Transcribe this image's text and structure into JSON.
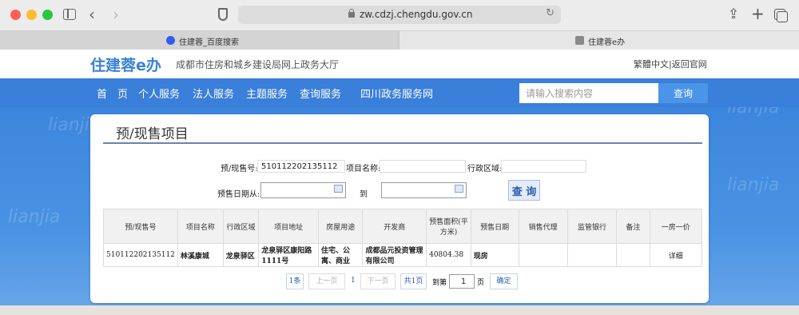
{
  "browser": {
    "url": "zw.cdzj.chengdu.gov.cn",
    "tabs": [
      {
        "label": "住建蓉_百度搜索"
      },
      {
        "label": "住建蓉e办"
      }
    ]
  },
  "site": {
    "logo": "住建蓉e办",
    "subtitle": "成都市住房和城乡建设局网上政务大厅",
    "lang_links": "繁體中文|返回官网"
  },
  "nav": {
    "items": [
      "首　页",
      "个人服务",
      "法人服务",
      "主题服务",
      "查询服务",
      "四川政务服务网"
    ],
    "search_placeholder": "请输入搜索内容",
    "search_button": "查询"
  },
  "watermark": "lianjia",
  "card": {
    "title": "预/现售项目",
    "filters": {
      "presale_no_label": "预/现售号:",
      "presale_no_value": "510112202135112",
      "project_name_label": "项目名称:",
      "district_label": "行政区域:",
      "date_from_label": "预售日期从:",
      "date_to_label": "到",
      "query_button": "查 询"
    },
    "table": {
      "headers": [
        "预/现售号",
        "项目名称",
        "行政区域",
        "项目地址",
        "房屋用途",
        "开发商",
        "预售面积(平方米)",
        "预售日期",
        "销售代理",
        "监管银行",
        "备注",
        "一房一价"
      ],
      "rows": [
        [
          "510112202135112",
          "林溪康城",
          "龙泉驿区",
          "龙泉驿区康阳路1111号",
          "住宅、公寓、商业",
          "成都品元投资管理有限公司",
          "40804.38",
          "现房",
          "",
          "",
          "",
          "详细"
        ]
      ]
    },
    "pager": {
      "count": "1条",
      "prev": "上一页",
      "current": "1",
      "next": "下一页",
      "total": "共1页",
      "goto_label": "到第",
      "goto_value": "1",
      "page_unit": "页",
      "confirm": "确定"
    }
  }
}
